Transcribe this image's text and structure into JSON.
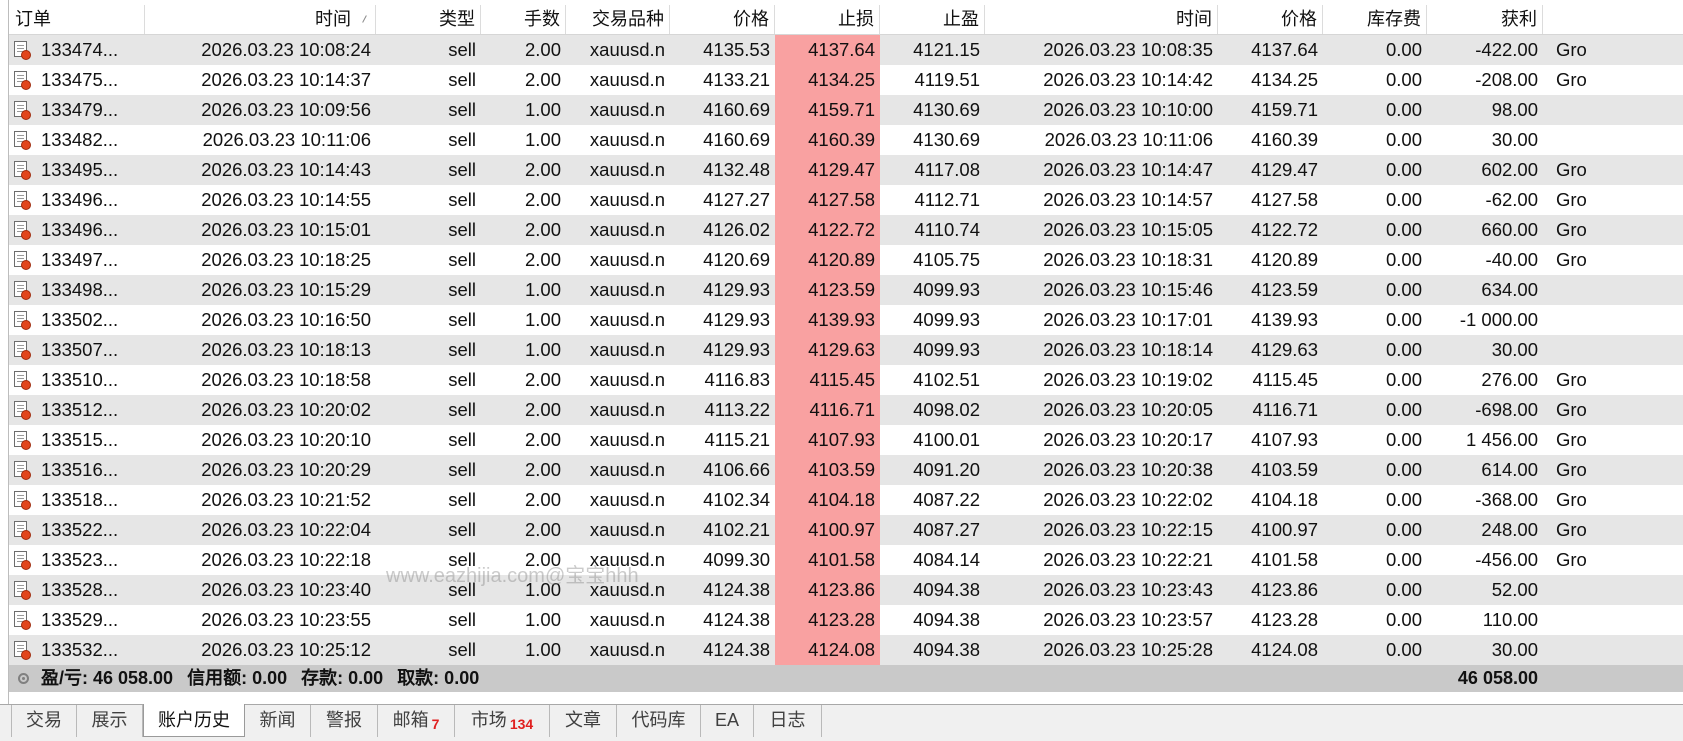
{
  "columns": [
    {
      "label": "订单"
    },
    {
      "label": "时间"
    },
    {
      "label": "类型"
    },
    {
      "label": "手数"
    },
    {
      "label": "交易品种"
    },
    {
      "label": "价格"
    },
    {
      "label": "止损"
    },
    {
      "label": "止盈"
    },
    {
      "label": "时间"
    },
    {
      "label": "价格"
    },
    {
      "label": "库存费"
    },
    {
      "label": "获利"
    }
  ],
  "rows": [
    [
      "133474...",
      "2026.03.23 10:08:24",
      "sell",
      "2.00",
      "xauusd.n",
      "4135.53",
      "4137.64",
      "4121.15",
      "2026.03.23 10:08:35",
      "4137.64",
      "0.00",
      "-422.00",
      "Gro"
    ],
    [
      "133475...",
      "2026.03.23 10:14:37",
      "sell",
      "2.00",
      "xauusd.n",
      "4133.21",
      "4134.25",
      "4119.51",
      "2026.03.23 10:14:42",
      "4134.25",
      "0.00",
      "-208.00",
      "Gro"
    ],
    [
      "133479...",
      "2026.03.23 10:09:56",
      "sell",
      "1.00",
      "xauusd.n",
      "4160.69",
      "4159.71",
      "4130.69",
      "2026.03.23 10:10:00",
      "4159.71",
      "0.00",
      "98.00",
      ""
    ],
    [
      "133482...",
      "2026.03.23 10:11:06",
      "sell",
      "1.00",
      "xauusd.n",
      "4160.69",
      "4160.39",
      "4130.69",
      "2026.03.23 10:11:06",
      "4160.39",
      "0.00",
      "30.00",
      ""
    ],
    [
      "133495...",
      "2026.03.23 10:14:43",
      "sell",
      "2.00",
      "xauusd.n",
      "4132.48",
      "4129.47",
      "4117.08",
      "2026.03.23 10:14:47",
      "4129.47",
      "0.00",
      "602.00",
      "Gro"
    ],
    [
      "133496...",
      "2026.03.23 10:14:55",
      "sell",
      "2.00",
      "xauusd.n",
      "4127.27",
      "4127.58",
      "4112.71",
      "2026.03.23 10:14:57",
      "4127.58",
      "0.00",
      "-62.00",
      "Gro"
    ],
    [
      "133496...",
      "2026.03.23 10:15:01",
      "sell",
      "2.00",
      "xauusd.n",
      "4126.02",
      "4122.72",
      "4110.74",
      "2026.03.23 10:15:05",
      "4122.72",
      "0.00",
      "660.00",
      "Gro"
    ],
    [
      "133497...",
      "2026.03.23 10:18:25",
      "sell",
      "2.00",
      "xauusd.n",
      "4120.69",
      "4120.89",
      "4105.75",
      "2026.03.23 10:18:31",
      "4120.89",
      "0.00",
      "-40.00",
      "Gro"
    ],
    [
      "133498...",
      "2026.03.23 10:15:29",
      "sell",
      "1.00",
      "xauusd.n",
      "4129.93",
      "4123.59",
      "4099.93",
      "2026.03.23 10:15:46",
      "4123.59",
      "0.00",
      "634.00",
      ""
    ],
    [
      "133502...",
      "2026.03.23 10:16:50",
      "sell",
      "1.00",
      "xauusd.n",
      "4129.93",
      "4139.93",
      "4099.93",
      "2026.03.23 10:17:01",
      "4139.93",
      "0.00",
      "-1 000.00",
      ""
    ],
    [
      "133507...",
      "2026.03.23 10:18:13",
      "sell",
      "1.00",
      "xauusd.n",
      "4129.93",
      "4129.63",
      "4099.93",
      "2026.03.23 10:18:14",
      "4129.63",
      "0.00",
      "30.00",
      ""
    ],
    [
      "133510...",
      "2026.03.23 10:18:58",
      "sell",
      "2.00",
      "xauusd.n",
      "4116.83",
      "4115.45",
      "4102.51",
      "2026.03.23 10:19:02",
      "4115.45",
      "0.00",
      "276.00",
      "Gro"
    ],
    [
      "133512...",
      "2026.03.23 10:20:02",
      "sell",
      "2.00",
      "xauusd.n",
      "4113.22",
      "4116.71",
      "4098.02",
      "2026.03.23 10:20:05",
      "4116.71",
      "0.00",
      "-698.00",
      "Gro"
    ],
    [
      "133515...",
      "2026.03.23 10:20:10",
      "sell",
      "2.00",
      "xauusd.n",
      "4115.21",
      "4107.93",
      "4100.01",
      "2026.03.23 10:20:17",
      "4107.93",
      "0.00",
      "1 456.00",
      "Gro"
    ],
    [
      "133516...",
      "2026.03.23 10:20:29",
      "sell",
      "2.00",
      "xauusd.n",
      "4106.66",
      "4103.59",
      "4091.20",
      "2026.03.23 10:20:38",
      "4103.59",
      "0.00",
      "614.00",
      "Gro"
    ],
    [
      "133518...",
      "2026.03.23 10:21:52",
      "sell",
      "2.00",
      "xauusd.n",
      "4102.34",
      "4104.18",
      "4087.22",
      "2026.03.23 10:22:02",
      "4104.18",
      "0.00",
      "-368.00",
      "Gro"
    ],
    [
      "133522...",
      "2026.03.23 10:22:04",
      "sell",
      "2.00",
      "xauusd.n",
      "4102.21",
      "4100.97",
      "4087.27",
      "2026.03.23 10:22:15",
      "4100.97",
      "0.00",
      "248.00",
      "Gro"
    ],
    [
      "133523...",
      "2026.03.23 10:22:18",
      "sell",
      "2.00",
      "xauusd.n",
      "4099.30",
      "4101.58",
      "4084.14",
      "2026.03.23 10:22:21",
      "4101.58",
      "0.00",
      "-456.00",
      "Gro"
    ],
    [
      "133528...",
      "2026.03.23 10:23:40",
      "sell",
      "1.00",
      "xauusd.n",
      "4124.38",
      "4123.86",
      "4094.38",
      "2026.03.23 10:23:43",
      "4123.86",
      "0.00",
      "52.00",
      ""
    ],
    [
      "133529...",
      "2026.03.23 10:23:55",
      "sell",
      "1.00",
      "xauusd.n",
      "4124.38",
      "4123.28",
      "4094.38",
      "2026.03.23 10:23:57",
      "4123.28",
      "0.00",
      "110.00",
      ""
    ],
    [
      "133532...",
      "2026.03.23 10:25:12",
      "sell",
      "1.00",
      "xauusd.n",
      "4124.38",
      "4124.08",
      "4094.38",
      "2026.03.23 10:25:28",
      "4124.08",
      "0.00",
      "30.00",
      ""
    ]
  ],
  "summary": {
    "items": [
      "盈/亏: 46 058.00",
      "信用额: 0.00",
      "存款: 0.00",
      "取款: 0.00"
    ],
    "total_profit": "46 058.00"
  },
  "tabs": [
    {
      "label": "交易"
    },
    {
      "label": "展示"
    },
    {
      "label": "账户历史",
      "active": true
    },
    {
      "label": "新闻"
    },
    {
      "label": "警报"
    },
    {
      "label": "邮箱",
      "badge": "7"
    },
    {
      "label": "市场",
      "badge": "134"
    },
    {
      "label": "文章"
    },
    {
      "label": "代码库"
    },
    {
      "label": "EA"
    },
    {
      "label": "日志"
    }
  ],
  "watermark": "www.eazhijia.com@宝宝hhh",
  "icons": {
    "order": "order-icon",
    "summary": "summary-icon",
    "sort": "sort-indicator-icon"
  },
  "colors": {
    "alt_row": "#e6e6e6",
    "stop_loss_bg": "#f9a1a1",
    "summary_bg": "#c9c9c9",
    "badge": "#e02020"
  }
}
